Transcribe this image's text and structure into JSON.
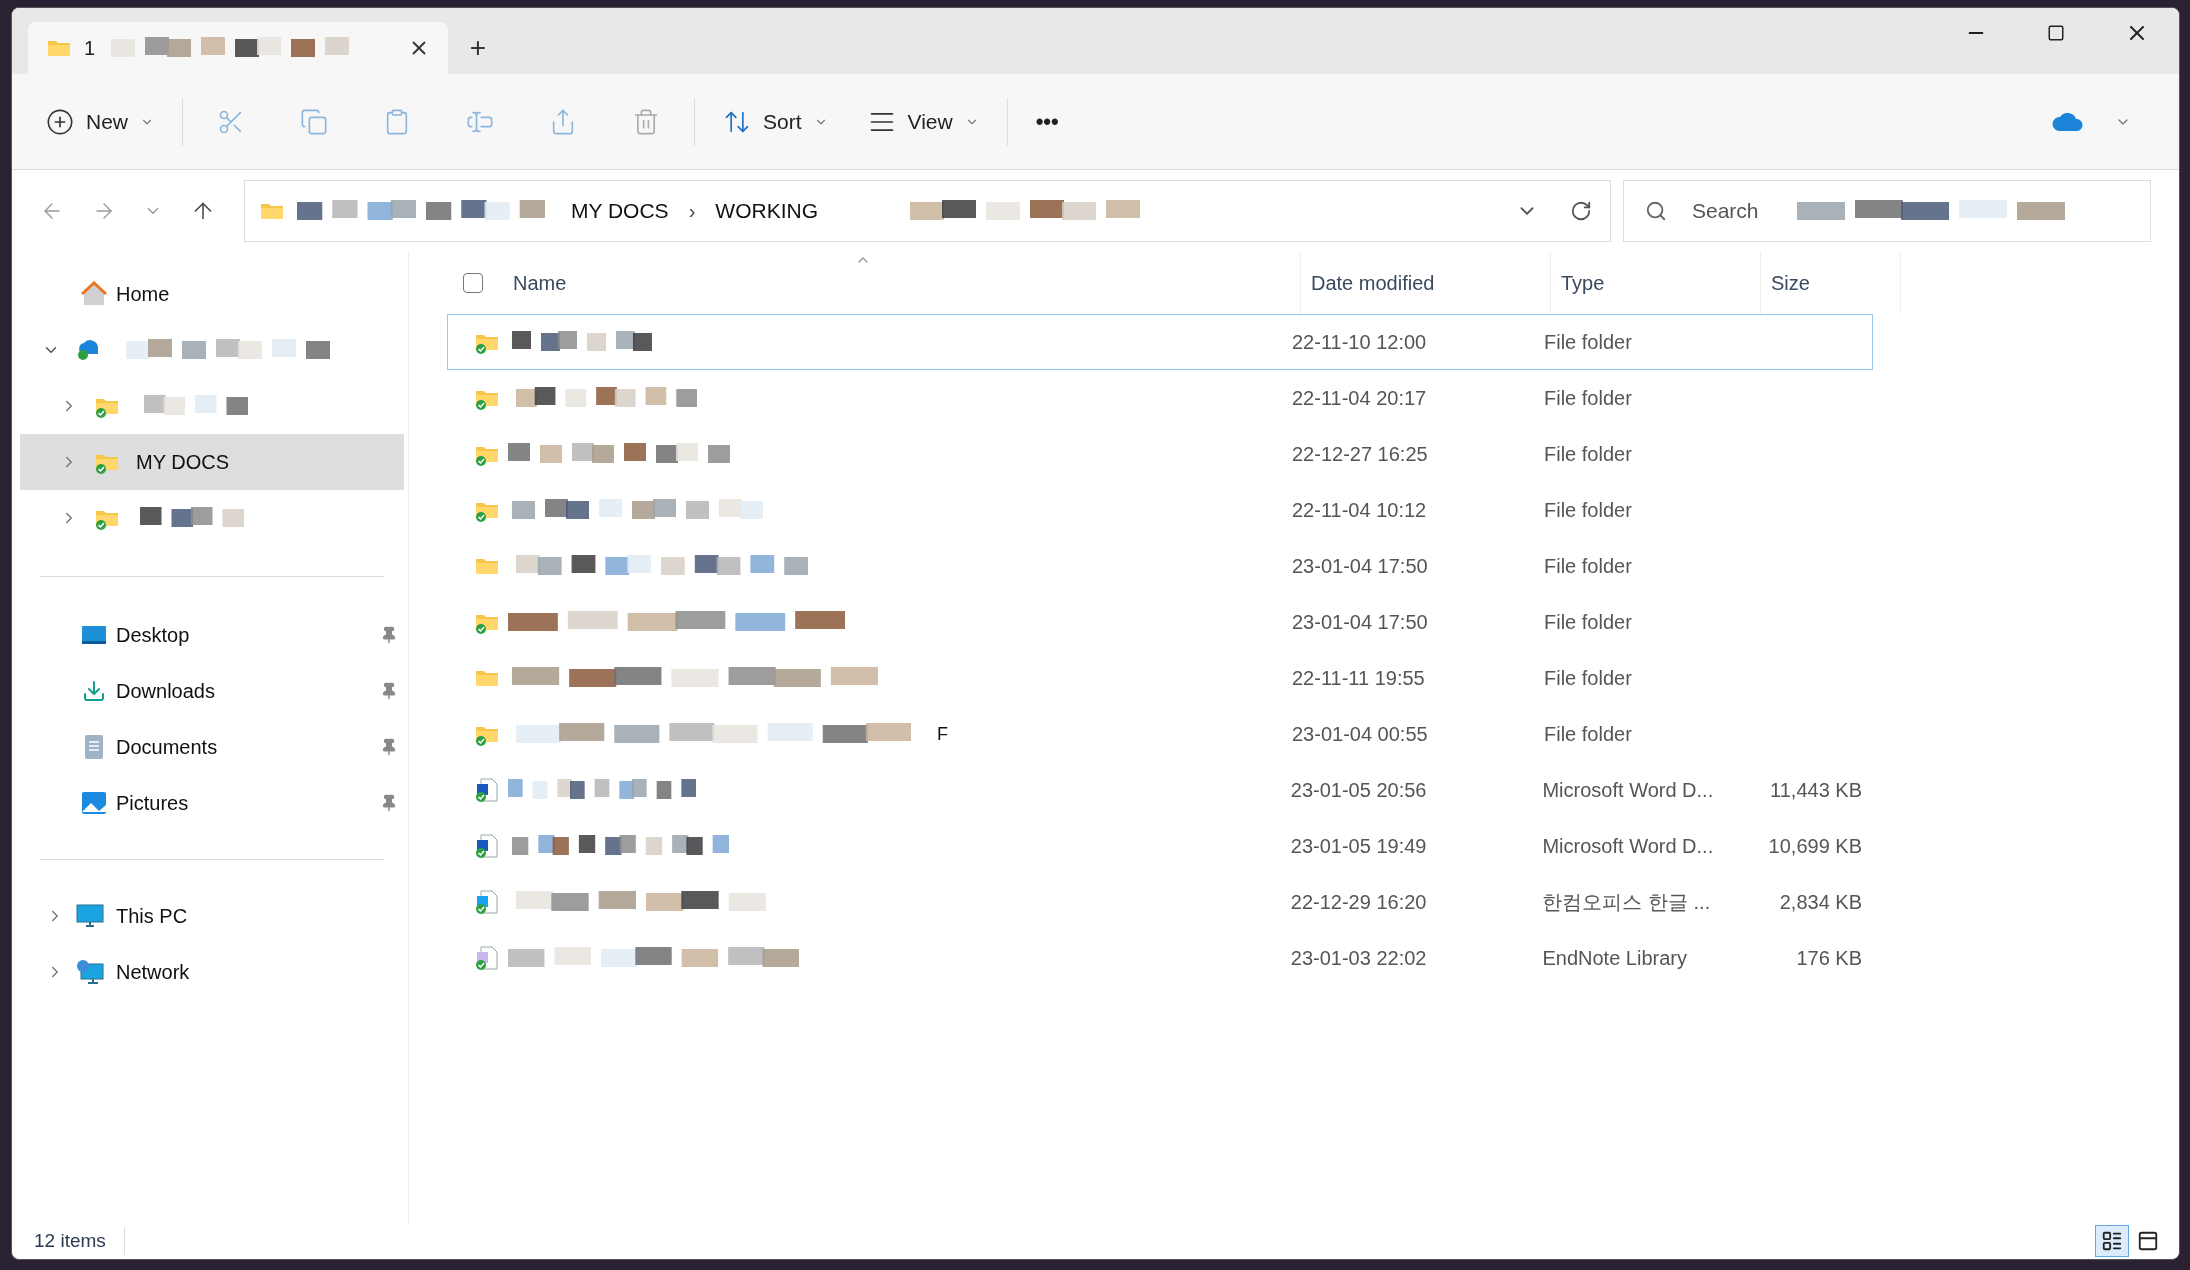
{
  "tab": {
    "title": "1",
    "plus": "+"
  },
  "toolbar": {
    "new": "New",
    "sort": "Sort",
    "view": "View",
    "more": "•••"
  },
  "address": {
    "crumbs": [
      "MY DOCS",
      "WORKING"
    ],
    "separator": "›"
  },
  "search": {
    "placeholder": "Search"
  },
  "sidebar": {
    "home": "Home",
    "tree": [
      {
        "kind": "cloud",
        "expanded": true,
        "selected": false,
        "children": [
          {
            "kind": "folder",
            "expanded": false,
            "selected": false
          },
          {
            "kind": "folder",
            "label": "MY DOCS",
            "expanded": false,
            "selected": true
          },
          {
            "kind": "folder",
            "expanded": false,
            "selected": false
          }
        ]
      }
    ],
    "quick": [
      {
        "label": "Desktop",
        "kind": "desktop",
        "pinned": true
      },
      {
        "label": "Downloads",
        "kind": "downloads",
        "pinned": true
      },
      {
        "label": "Documents",
        "kind": "documents",
        "pinned": true
      },
      {
        "label": "Pictures",
        "kind": "pictures",
        "pinned": true
      }
    ],
    "places": [
      {
        "label": "This PC",
        "kind": "pc",
        "expanded": false
      },
      {
        "label": "Network",
        "kind": "network",
        "expanded": false
      }
    ]
  },
  "select_all": {
    "checked": false
  },
  "columns": [
    "Name",
    "Date modified",
    "Type",
    "Size"
  ],
  "rows": [
    {
      "kind": "folder",
      "synced": true,
      "selected": true,
      "date": "22-11-10 12:00",
      "type": "File folder"
    },
    {
      "kind": "folder",
      "synced": true,
      "selected": false,
      "date": "22-11-04 20:17",
      "type": "File folder"
    },
    {
      "kind": "folder",
      "synced": true,
      "selected": false,
      "date": "22-12-27 16:25",
      "type": "File folder"
    },
    {
      "kind": "folder",
      "synced": true,
      "selected": false,
      "date": "22-11-04 10:12",
      "type": "File folder"
    },
    {
      "kind": "folder",
      "synced": false,
      "selected": false,
      "date": "23-01-04 17:50",
      "type": "File folder"
    },
    {
      "kind": "folder",
      "synced": true,
      "selected": false,
      "date": "23-01-04 17:50",
      "type": "File folder"
    },
    {
      "kind": "folder",
      "synced": false,
      "selected": false,
      "date": "22-11-11 19:55",
      "type": "File folder"
    },
    {
      "kind": "folder",
      "synced": true,
      "selected": false,
      "name_fragment": "F",
      "date": "23-01-04 00:55",
      "type": "File folder"
    },
    {
      "kind": "word",
      "synced": true,
      "selected": false,
      "date": "23-01-05 20:56",
      "type": "Microsoft Word D...",
      "size": "11,443 KB"
    },
    {
      "kind": "word",
      "synced": true,
      "selected": false,
      "date": "23-01-05 19:49",
      "type": "Microsoft Word D...",
      "size": "10,699 KB"
    },
    {
      "kind": "hwp",
      "synced": true,
      "selected": false,
      "date": "22-12-29 16:20",
      "type": "한컴오피스 한글 ...",
      "size": "2,834 KB"
    },
    {
      "kind": "endnote",
      "synced": true,
      "selected": false,
      "date": "23-01-03 22:02",
      "type": "EndNote Library",
      "size": "176 KB"
    }
  ],
  "status_bar": {
    "count": "12 items",
    "view_modes": [
      {
        "kind": "details",
        "selected": true
      },
      {
        "kind": "tiles",
        "selected": false
      }
    ]
  }
}
